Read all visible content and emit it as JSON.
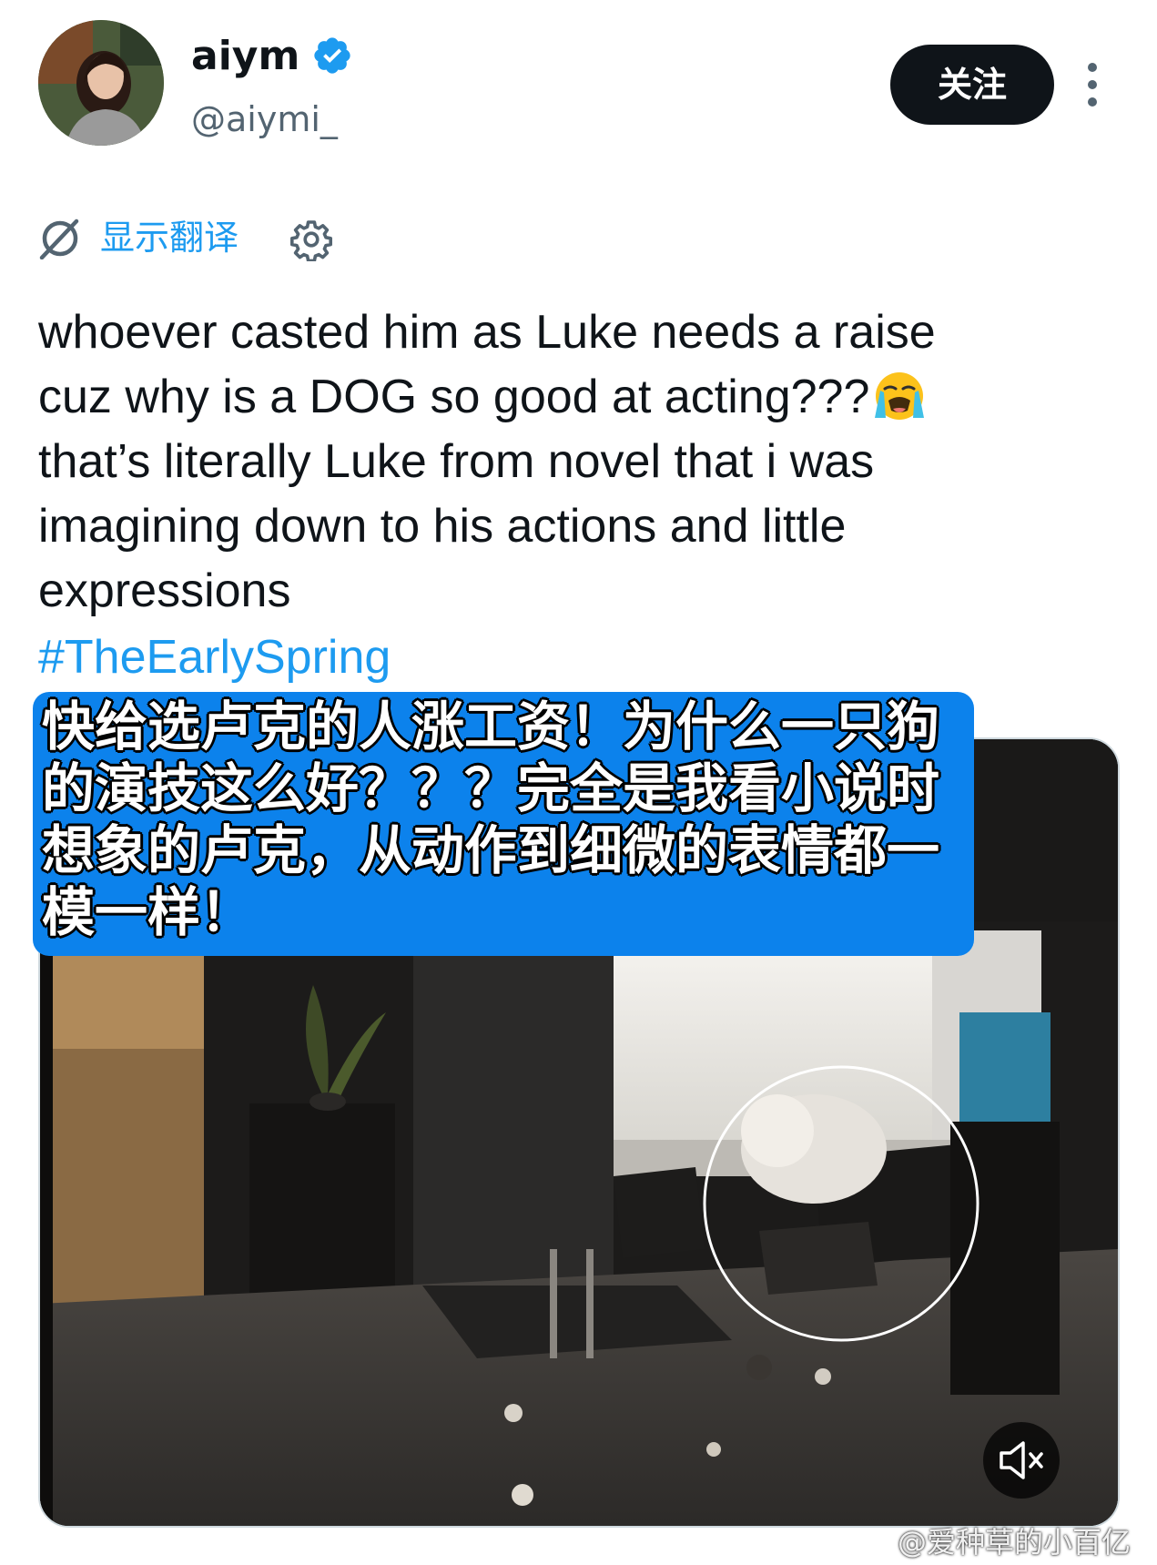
{
  "author": {
    "display_name": "aiym",
    "handle": "@aiymi_",
    "verified_icon": "verified-badge-icon",
    "avatar_icon": "avatar"
  },
  "actions": {
    "follow_label": "关注",
    "more_icon": "more-vertical-icon"
  },
  "translate": {
    "label": "显示翻译",
    "icon": "translate-icon",
    "settings_icon": "gear-icon"
  },
  "tweet": {
    "lines": [
      "whoever casted him as Luke needs a raise",
      "cuz why is a DOG so good at acting???",
      "that’s literally Luke from novel that i was",
      "imagining down to his actions and little",
      "expressions"
    ],
    "emoji": "loudly-crying-face-icon",
    "hashtag": "#TheEarlySpring"
  },
  "caption": {
    "lines": [
      "快给选卢克的人涨工资！为什么一只狗",
      "的演技这么好？？？完全是我看小说时",
      "想象的卢克，从动作到细微的表情都一",
      "模一样！"
    ]
  },
  "video": {
    "mute_icon": "muted-speaker-icon"
  },
  "watermark": {
    "text": "@爱种草的小百亿",
    "icon": "weibo-logo-icon"
  },
  "colors": {
    "accent": "#1d9bf0",
    "caption_bg": "#0c82ec",
    "text": "#0f1419",
    "muted": "#536471"
  }
}
